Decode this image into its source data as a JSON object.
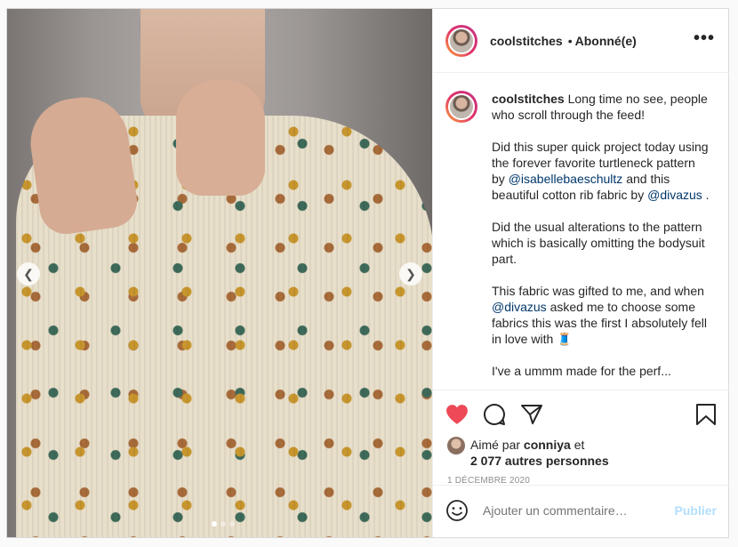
{
  "post": {
    "username": "coolstitches",
    "separator": "•",
    "follow_status": "Abonné(e)",
    "more_icon": "more-options-icon"
  },
  "caption": {
    "username": "coolstitches",
    "p1": "Long time no see, people who scroll through the feed!",
    "p2_a": "Did this super quick project today using the forever favorite turtleneck pattern by ",
    "p2_m1": "@isabellebaeschultz",
    "p2_b": " and this beautiful cotton rib fabric by ",
    "p2_m2": "@divazus",
    "p2_c": " .",
    "p3": "Did the usual alterations to the pattern which is basically omitting the bodysuit part.",
    "p4_a": "This fabric was gifted to me, and when ",
    "p4_m": "@divazus",
    "p4_b": " asked me to choose some fabrics this was the first I absolutely fell in love with 🧵",
    "p5": "I've a ummm made for the perf..."
  },
  "likes": {
    "prefix": "Aimé par ",
    "user": "conniya",
    "middle": " et",
    "count": "2 077 autres personnes"
  },
  "date": "1 DÉCEMBRE 2020",
  "comment_input": {
    "placeholder": "Ajouter un commentaire…",
    "post_label": "Publier"
  },
  "carousel": {
    "slide_count": 3,
    "active_index": 0
  },
  "colors": {
    "heart": "#ed4956",
    "link": "#00376b",
    "post_disabled": "#b2dffc"
  }
}
